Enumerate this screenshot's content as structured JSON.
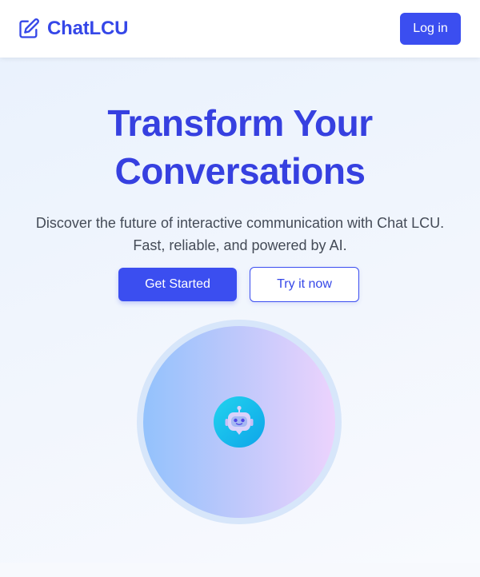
{
  "header": {
    "brand_name": "ChatLCU",
    "brand_icon": "edit-icon",
    "login_label": "Log in"
  },
  "hero": {
    "headline_line1": "Transform Your",
    "headline_line2": "Conversations",
    "subtitle_line1": "Discover the future of interactive communication with Chat LCU.",
    "subtitle_line2": "Fast, reliable, and powered by AI.",
    "primary_cta": "Get Started",
    "secondary_cta": "Try it now",
    "illustration_icon": "robot-chat-icon"
  },
  "colors": {
    "accent": "#3b4ef0",
    "headline": "#3640e0",
    "body_text": "#444b57",
    "orb_left": "#93c2fc",
    "orb_right": "#ecd3fd",
    "bot_badge_from": "#22d3ee",
    "bot_badge_to": "#0ea5e9"
  }
}
